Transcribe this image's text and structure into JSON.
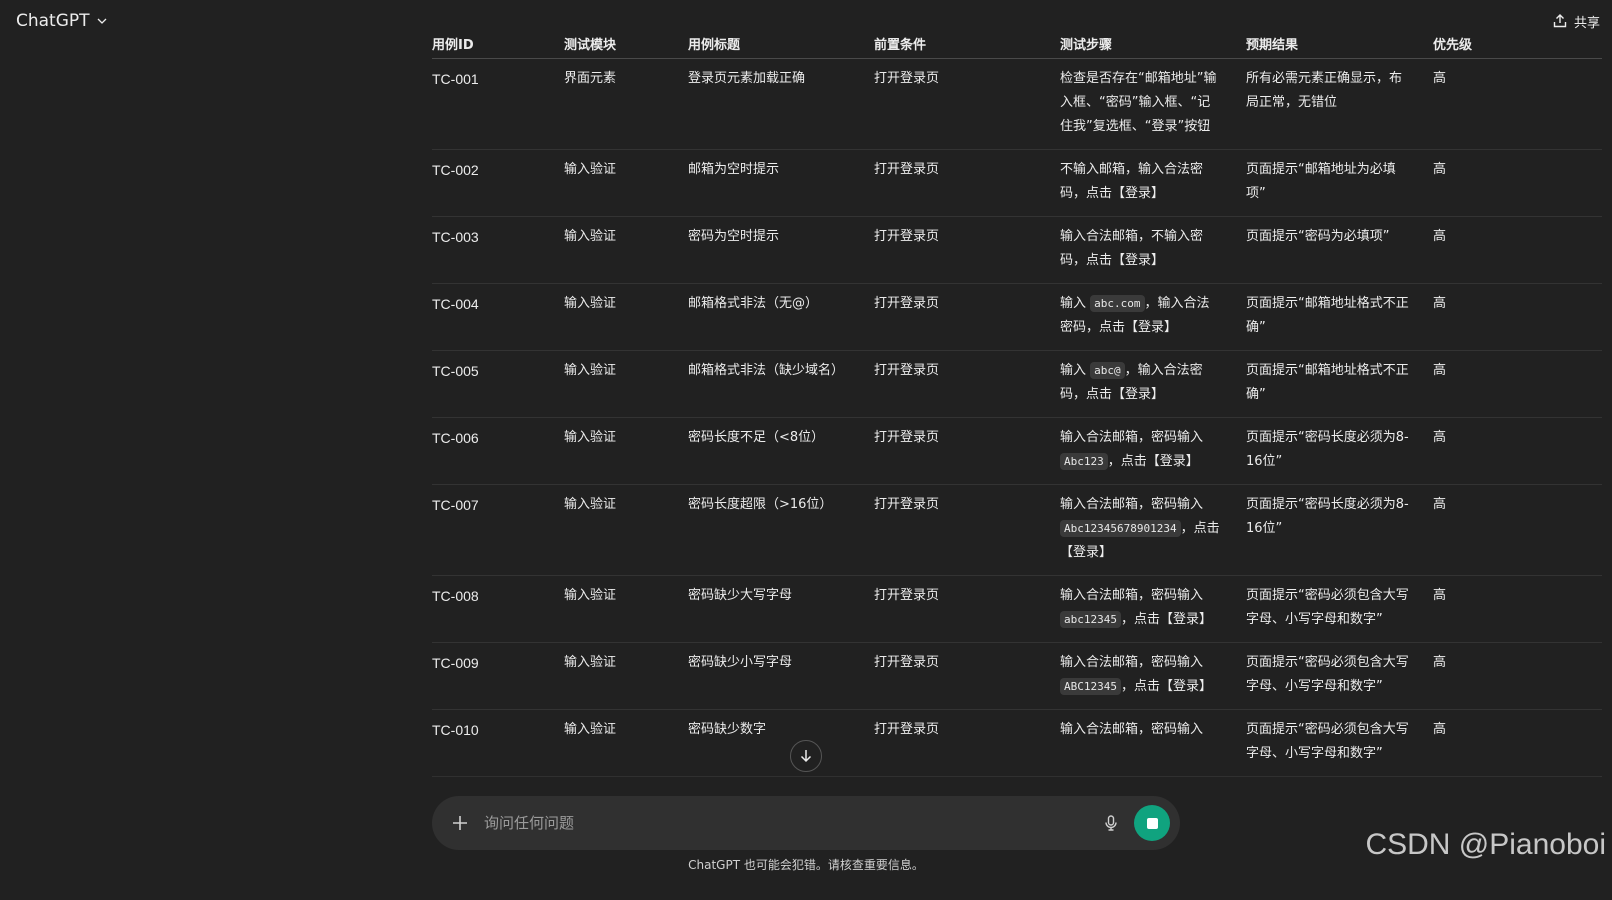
{
  "header": {
    "model_label": "ChatGPT",
    "share_label": "共享"
  },
  "table": {
    "headers": [
      "用例ID",
      "测试模块",
      "用例标题",
      "前置条件",
      "测试步骤",
      "预期结果",
      "优先级"
    ],
    "rows": [
      {
        "id": "TC-001",
        "module": "界面元素",
        "title": "登录页元素加载正确",
        "pre": "打开登录页",
        "steps": [
          {
            "t": "检查是否存在“邮箱地址”输入框、“密码”输入框、“记住我”复选框、“登录”按钮"
          }
        ],
        "expected": "所有必需元素正确显示，布局正常，无错位",
        "priority": "高"
      },
      {
        "id": "TC-002",
        "module": "输入验证",
        "title": "邮箱为空时提示",
        "pre": "打开登录页",
        "steps": [
          {
            "t": "不输入邮箱，输入合法密码，点击【登录】"
          }
        ],
        "expected": "页面提示“邮箱地址为必填项”",
        "priority": "高"
      },
      {
        "id": "TC-003",
        "module": "输入验证",
        "title": "密码为空时提示",
        "pre": "打开登录页",
        "steps": [
          {
            "t": "输入合法邮箱，不输入密码，点击【登录】"
          }
        ],
        "expected": "页面提示“密码为必填项”",
        "priority": "高"
      },
      {
        "id": "TC-004",
        "module": "输入验证",
        "title": "邮箱格式非法（无@）",
        "pre": "打开登录页",
        "steps": [
          {
            "t": "输入 "
          },
          {
            "c": "abc.com"
          },
          {
            "t": "，输入合法密码，点击【登录】"
          }
        ],
        "expected": "页面提示“邮箱地址格式不正确”",
        "priority": "高"
      },
      {
        "id": "TC-005",
        "module": "输入验证",
        "title": "邮箱格式非法（缺少域名）",
        "pre": "打开登录页",
        "steps": [
          {
            "t": "输入 "
          },
          {
            "c": "abc@"
          },
          {
            "t": "，输入合法密码，点击【登录】"
          }
        ],
        "expected": "页面提示“邮箱地址格式不正确”",
        "priority": "高"
      },
      {
        "id": "TC-006",
        "module": "输入验证",
        "title": "密码长度不足（<8位）",
        "pre": "打开登录页",
        "steps": [
          {
            "t": "输入合法邮箱，密码输入 "
          },
          {
            "c": "Abc123"
          },
          {
            "t": "，点击【登录】"
          }
        ],
        "expected": "页面提示“密码长度必须为8-16位”",
        "priority": "高"
      },
      {
        "id": "TC-007",
        "module": "输入验证",
        "title": "密码长度超限（>16位）",
        "pre": "打开登录页",
        "steps": [
          {
            "t": "输入合法邮箱，密码输入 "
          },
          {
            "c": "Abc12345678901234"
          },
          {
            "t": "，点击【登录】"
          }
        ],
        "expected": "页面提示“密码长度必须为8-16位”",
        "priority": "高"
      },
      {
        "id": "TC-008",
        "module": "输入验证",
        "title": "密码缺少大写字母",
        "pre": "打开登录页",
        "steps": [
          {
            "t": "输入合法邮箱，密码输入 "
          },
          {
            "c": "abc12345"
          },
          {
            "t": "，点击【登录】"
          }
        ],
        "expected": "页面提示“密码必须包含大写字母、小写字母和数字”",
        "priority": "高"
      },
      {
        "id": "TC-009",
        "module": "输入验证",
        "title": "密码缺少小写字母",
        "pre": "打开登录页",
        "steps": [
          {
            "t": "输入合法邮箱，密码输入 "
          },
          {
            "c": "ABC12345"
          },
          {
            "t": "，点击【登录】"
          }
        ],
        "expected": "页面提示“密码必须包含大写字母、小写字母和数字”",
        "priority": "高"
      },
      {
        "id": "TC-010",
        "module": "输入验证",
        "title": "密码缺少数字",
        "pre": "打开登录页",
        "steps": [
          {
            "t": "输入合法邮箱，密码输入"
          }
        ],
        "expected": "页面提示“密码必须包含大写字母、小写字母和数字”",
        "priority": "高"
      }
    ]
  },
  "composer": {
    "placeholder": "询问任何问题"
  },
  "footer": {
    "disclaimer": "ChatGPT 也可能会犯错。请核查重要信息。"
  },
  "watermark": "CSDN @Pianoboi",
  "colors": {
    "background": "#212121",
    "composer": "#303030",
    "accent_stop": "#10a37f"
  },
  "icons": [
    "chevron-down-icon",
    "share-icon",
    "arrow-down-icon",
    "plus-icon",
    "microphone-icon",
    "stop-icon"
  ]
}
